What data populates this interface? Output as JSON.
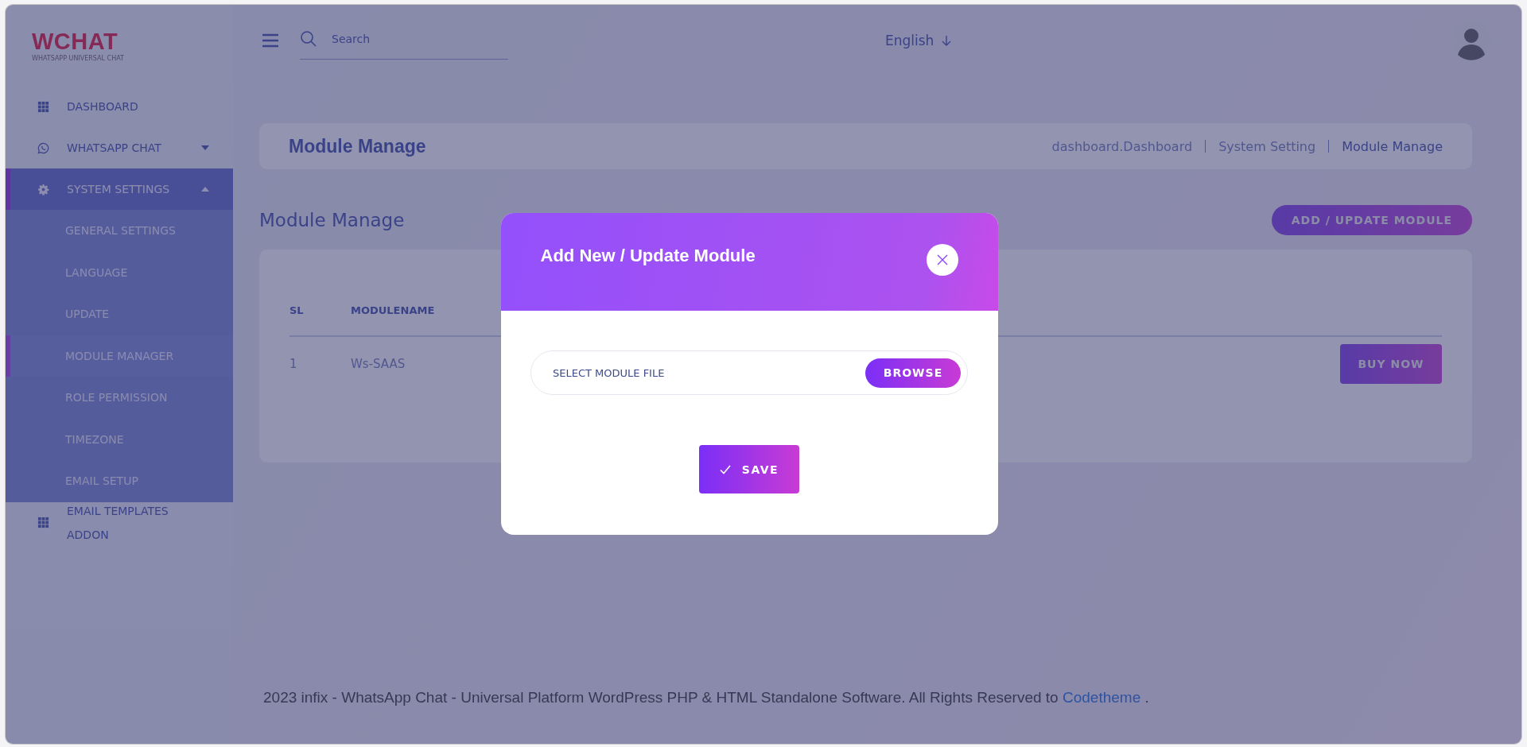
{
  "logo": {
    "title": "WCHAT",
    "subtitle": "WHATSAPP UNIVERSAL CHAT"
  },
  "sidebar": {
    "items": [
      {
        "label": "DASHBOARD",
        "selected": false
      },
      {
        "label": "WHATSAPP CHAT",
        "selected": false,
        "expanded": false
      },
      {
        "label": "SYSTEM SETTINGS",
        "selected": true,
        "expanded": true,
        "children": [
          {
            "label": "GENERAL SETTINGS",
            "selected": false
          },
          {
            "label": "LANGUAGE",
            "selected": false
          },
          {
            "label": "UPDATE",
            "selected": false
          },
          {
            "label": "MODULE MANAGER",
            "selected": true
          },
          {
            "label": "ROLE PERMISSION",
            "selected": false
          },
          {
            "label": "TIMEZONE",
            "selected": false
          },
          {
            "label": "EMAIL SETUP",
            "selected": false
          }
        ]
      },
      {
        "label": "EMAIL TEMPLATES ADDON",
        "selected": false
      }
    ]
  },
  "topbar": {
    "search": {
      "placeholder": "Search"
    },
    "language": "English"
  },
  "breadcrumb": {
    "title": "Module Manage",
    "path": [
      "dashboard.Dashboard",
      "System Setting",
      "Module Manage"
    ]
  },
  "page": {
    "title": "Module Manage",
    "add_button": "ADD / UPDATE MODULE"
  },
  "table": {
    "columns": [
      "SL",
      "MODULENAME"
    ],
    "rows": [
      {
        "cells": [
          "1",
          "Ws-SAAS"
        ],
        "action": "BUY NOW"
      }
    ]
  },
  "modal": {
    "title": "Add New / Update Module",
    "file_field": {
      "placeholder": "SELECT MODULE FILE"
    },
    "browse_button": "BROWSE",
    "save_button": "SAVE"
  },
  "footer": {
    "text": "2023 infix - WhatsApp Chat - Universal Platform WordPress PHP & HTML Standalone Software. All Rights Reserved to",
    "link": "Codetheme",
    "end": "."
  }
}
